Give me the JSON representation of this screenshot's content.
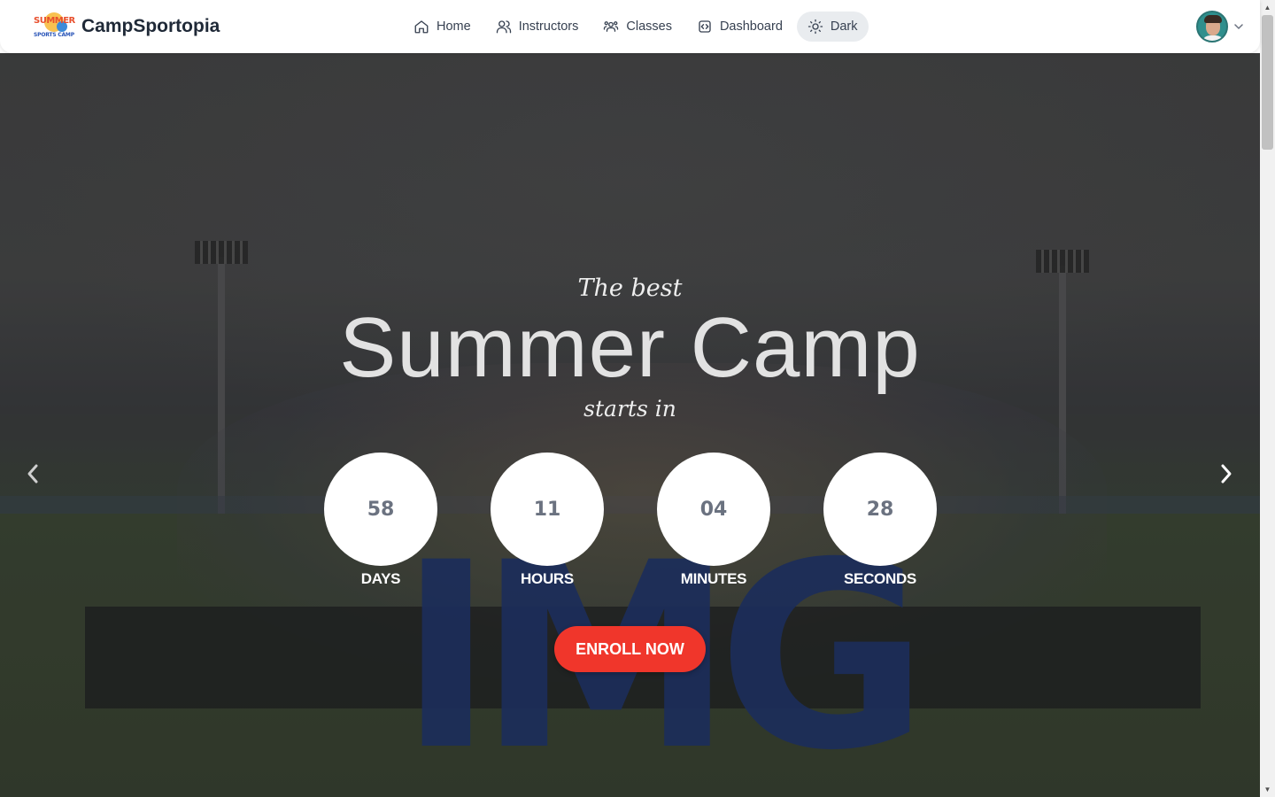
{
  "brand": {
    "name": "CampSportopia",
    "logo_text_top": "SUMMER",
    "logo_text_bottom": "SPORTS CAMP"
  },
  "nav": {
    "items": [
      {
        "label": "Home",
        "icon": "home-icon"
      },
      {
        "label": "Instructors",
        "icon": "users-icon"
      },
      {
        "label": "Classes",
        "icon": "group-icon"
      },
      {
        "label": "Dashboard",
        "icon": "code-square-icon"
      },
      {
        "label": "Dark",
        "icon": "sun-icon",
        "active": true
      }
    ]
  },
  "hero": {
    "tagline_top": "The best",
    "headline": "Summer Camp",
    "tagline_bottom": "starts in",
    "background_letters": "IMG",
    "countdown": [
      {
        "value": "58",
        "label": "DAYS"
      },
      {
        "value": "11",
        "label": "HOURS"
      },
      {
        "value": "04",
        "label": "MINUTES"
      },
      {
        "value": "28",
        "label": "SECONDS"
      }
    ],
    "cta_label": "ENROLL NOW"
  },
  "colors": {
    "accent": "#f0362b",
    "nav_text": "#374151",
    "brand_text": "#1f2937",
    "countdown_value": "#6b7280"
  }
}
